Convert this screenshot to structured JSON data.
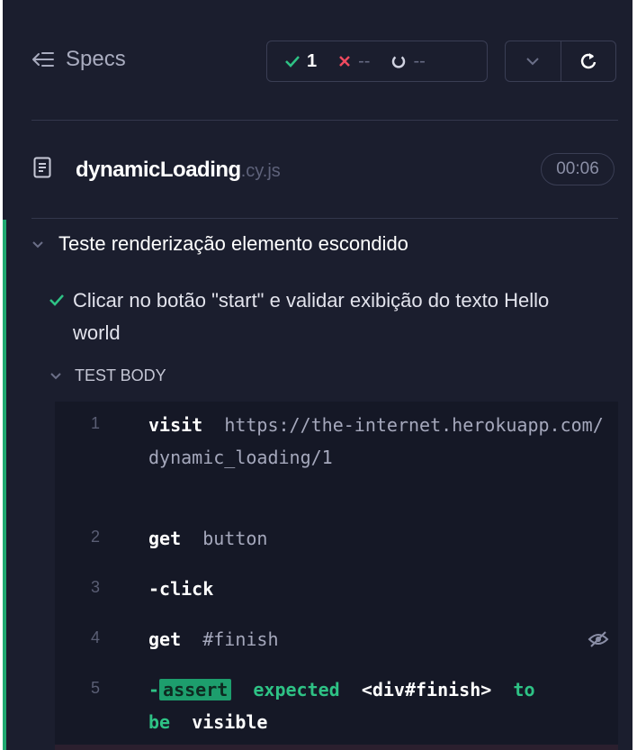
{
  "header": {
    "specs_label": "Specs",
    "stats": {
      "passed": "1",
      "failed": "--",
      "pending": "--"
    }
  },
  "file": {
    "name": "dynamicLoading",
    "ext": ".cy.js",
    "duration": "00:06"
  },
  "suite": {
    "title": "Teste renderização elemento escondido"
  },
  "test": {
    "title": "Clicar no botão \"start\" e validar exibição do texto Hello world",
    "body_label": "TEST BODY"
  },
  "commands": [
    {
      "num": "1",
      "name": "visit",
      "arg": "https://the-internet.herokuapp.com/dynamic_loading/1"
    },
    {
      "num": "2",
      "name": "get",
      "arg": "button"
    },
    {
      "num": "3",
      "name": "-click",
      "arg": ""
    },
    {
      "num": "4",
      "name": "get",
      "arg": "#finish"
    },
    {
      "num": "5",
      "dash": "-",
      "badge": "assert",
      "expected": "expected",
      "subject": "<div#finish>",
      "to": "to",
      "be": "be",
      "visible": "visible"
    }
  ],
  "colors": {
    "pass": "#1fa971",
    "fail": "#f04a5f",
    "background": "#1b1e2e"
  }
}
